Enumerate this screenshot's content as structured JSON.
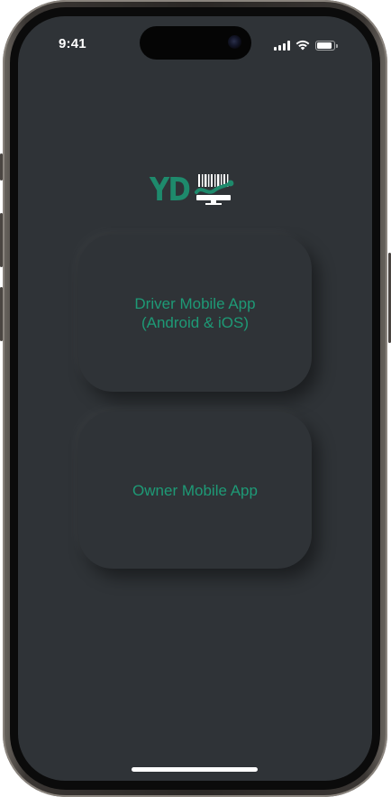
{
  "status_bar": {
    "time": "9:41",
    "signal_icon": "cellular-signal-icon",
    "wifi_icon": "wifi-icon",
    "battery_icon": "battery-icon",
    "battery_level": 0.9
  },
  "logo": {
    "text": "YD",
    "mark_icon": "barcode-dispatch-icon",
    "color": "#1e8a6c"
  },
  "cards": [
    {
      "line1": "Driver Mobile App",
      "line2": "(Android & iOS)"
    },
    {
      "line1": "Owner Mobile App"
    }
  ],
  "colors": {
    "screen_background": "#2f3337",
    "accent": "#1e9a76",
    "status_text": "#ffffff"
  }
}
